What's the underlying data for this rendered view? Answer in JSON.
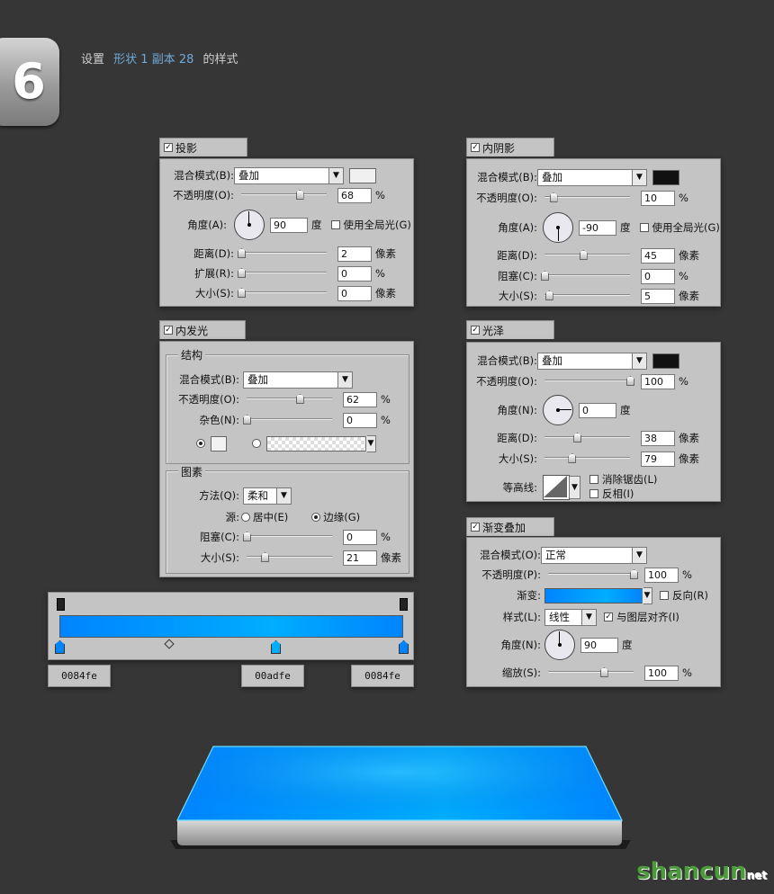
{
  "step": {
    "number": "6"
  },
  "heading": {
    "prefix": "设置",
    "layer": "形状 1 副本 28",
    "suffix": "的样式"
  },
  "drop_shadow": {
    "title": "投影",
    "blend_label": "混合模式(B):",
    "blend_value": "叠加",
    "blend_color": "#f0f0f0",
    "opacity_label": "不透明度(O):",
    "opacity": "68",
    "opacity_pct": 68,
    "opacity_unit": "%",
    "angle_label": "角度(A):",
    "angle": "90",
    "angle_unit": "度",
    "global_light_label": "使用全局光(G)",
    "distance_label": "距离(D):",
    "distance": "2",
    "distance_unit": "像素",
    "spread_label": "扩展(R):",
    "spread": "0",
    "spread_unit": "%",
    "size_label": "大小(S):",
    "size": "0",
    "size_unit": "像素"
  },
  "inner_shadow": {
    "title": "内阴影",
    "blend_label": "混合模式(B):",
    "blend_value": "叠加",
    "blend_color": "#111111",
    "opacity_label": "不透明度(O):",
    "opacity": "10",
    "opacity_pct": 10,
    "opacity_unit": "%",
    "angle_label": "角度(A):",
    "angle": "-90",
    "angle_unit": "度",
    "global_light_label": "使用全局光(G)",
    "distance_label": "距离(D):",
    "distance": "45",
    "distance_unit": "像素",
    "choke_label": "阻塞(C):",
    "choke": "0",
    "choke_unit": "%",
    "size_label": "大小(S):",
    "size": "5",
    "size_unit": "像素"
  },
  "inner_glow": {
    "title": "内发光",
    "structure_label": "结构",
    "blend_label": "混合模式(B):",
    "blend_value": "叠加",
    "opacity_label": "不透明度(O):",
    "opacity": "62",
    "opacity_pct": 62,
    "opacity_unit": "%",
    "noise_label": "杂色(N):",
    "noise": "0",
    "noise_unit": "%",
    "elements_label": "图素",
    "technique_label": "方法(Q):",
    "technique_value": "柔和",
    "source_label": "源:",
    "source_center": "居中(E)",
    "source_edge": "边缘(G)",
    "choke_label": "阻塞(C):",
    "choke": "0",
    "choke_unit": "%",
    "size_label": "大小(S):",
    "size": "21",
    "size_unit": "像素"
  },
  "satin": {
    "title": "光泽",
    "blend_label": "混合模式(B):",
    "blend_value": "叠加",
    "blend_color": "#111111",
    "opacity_label": "不透明度(O):",
    "opacity": "100",
    "opacity_pct": 100,
    "opacity_unit": "%",
    "angle_label": "角度(N):",
    "angle": "0",
    "angle_unit": "度",
    "distance_label": "距离(D):",
    "distance": "38",
    "distance_unit": "像素",
    "size_label": "大小(S):",
    "size": "79",
    "size_unit": "像素",
    "contour_label": "等高线:",
    "antialias_label": "消除锯齿(L)",
    "invert_label": "反相(I)"
  },
  "gradient_overlay": {
    "title": "渐变叠加",
    "blend_label": "混合模式(O):",
    "blend_value": "正常",
    "opacity_label": "不透明度(P):",
    "opacity": "100",
    "opacity_pct": 100,
    "opacity_unit": "%",
    "gradient_label": "渐变:",
    "reverse_label": "反向(R)",
    "style_label": "样式(L):",
    "style_value": "线性",
    "align_label": "与图层对齐(I)",
    "angle_label": "角度(N):",
    "angle": "90",
    "angle_unit": "度",
    "scale_label": "缩放(S):",
    "scale": "100",
    "scale_unit": "%"
  },
  "gradient_stops": {
    "left": "0084fe",
    "middle": "00adfe",
    "right": "0084fe"
  },
  "colors": {
    "gradient_start": "#0084fe",
    "gradient_mid": "#00adfe",
    "gradient_end": "#0084fe"
  },
  "watermark": {
    "main": "shancun",
    "sub": "net"
  }
}
